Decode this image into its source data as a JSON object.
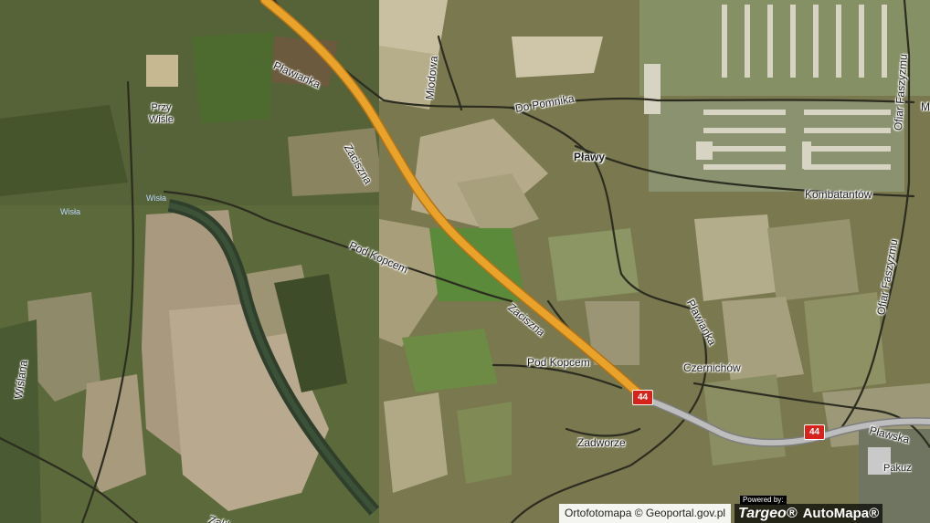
{
  "map": {
    "colors": {
      "main_road": "#e9a32a",
      "main_road_edge": "#b27216",
      "secondary_road": "#b9b9b9",
      "local_road": "#2a2a20",
      "route_shield": "#d8221c"
    },
    "labels": {
      "plawianka_north": "Pławianka",
      "przy_wisle": "Przy\nWiśle",
      "zaciszna_north": "Zaciszna",
      "miodowa": "Miodowa",
      "do_pomnika": "Do Pomnika",
      "plawy": "Pławy",
      "kombatantow": "Kombatantów",
      "ofiar_faszyzmu_north": "Ofiar Faszyzmu",
      "ofiar_faszyzmu_south": "Ofiar Faszyzmu",
      "pod_kopcem_west": "Pod Kopcem",
      "zaciszna_south": "Zaciszna",
      "plawianka_east": "Pławianka",
      "pod_kopcem_south": "Pod Kopcem",
      "czernichow": "Czernichów",
      "zadworze": "Zadworze",
      "plawska": "Pławska",
      "pakuz": "Pakuz",
      "wislana": "Wiślana",
      "zak_partial": "Zakl",
      "m_partial": "M",
      "wisla_water": "Wisła",
      "wisla_water_2": "Wisła"
    },
    "route_shields": [
      "44",
      "44"
    ]
  },
  "footer": {
    "attribution": "Ortofotomapa © Geoportal.gov.pl",
    "powered_by": "Powered by:",
    "brand_targeo": "Targeo®",
    "brand_automapa": "AutoMapa®"
  }
}
